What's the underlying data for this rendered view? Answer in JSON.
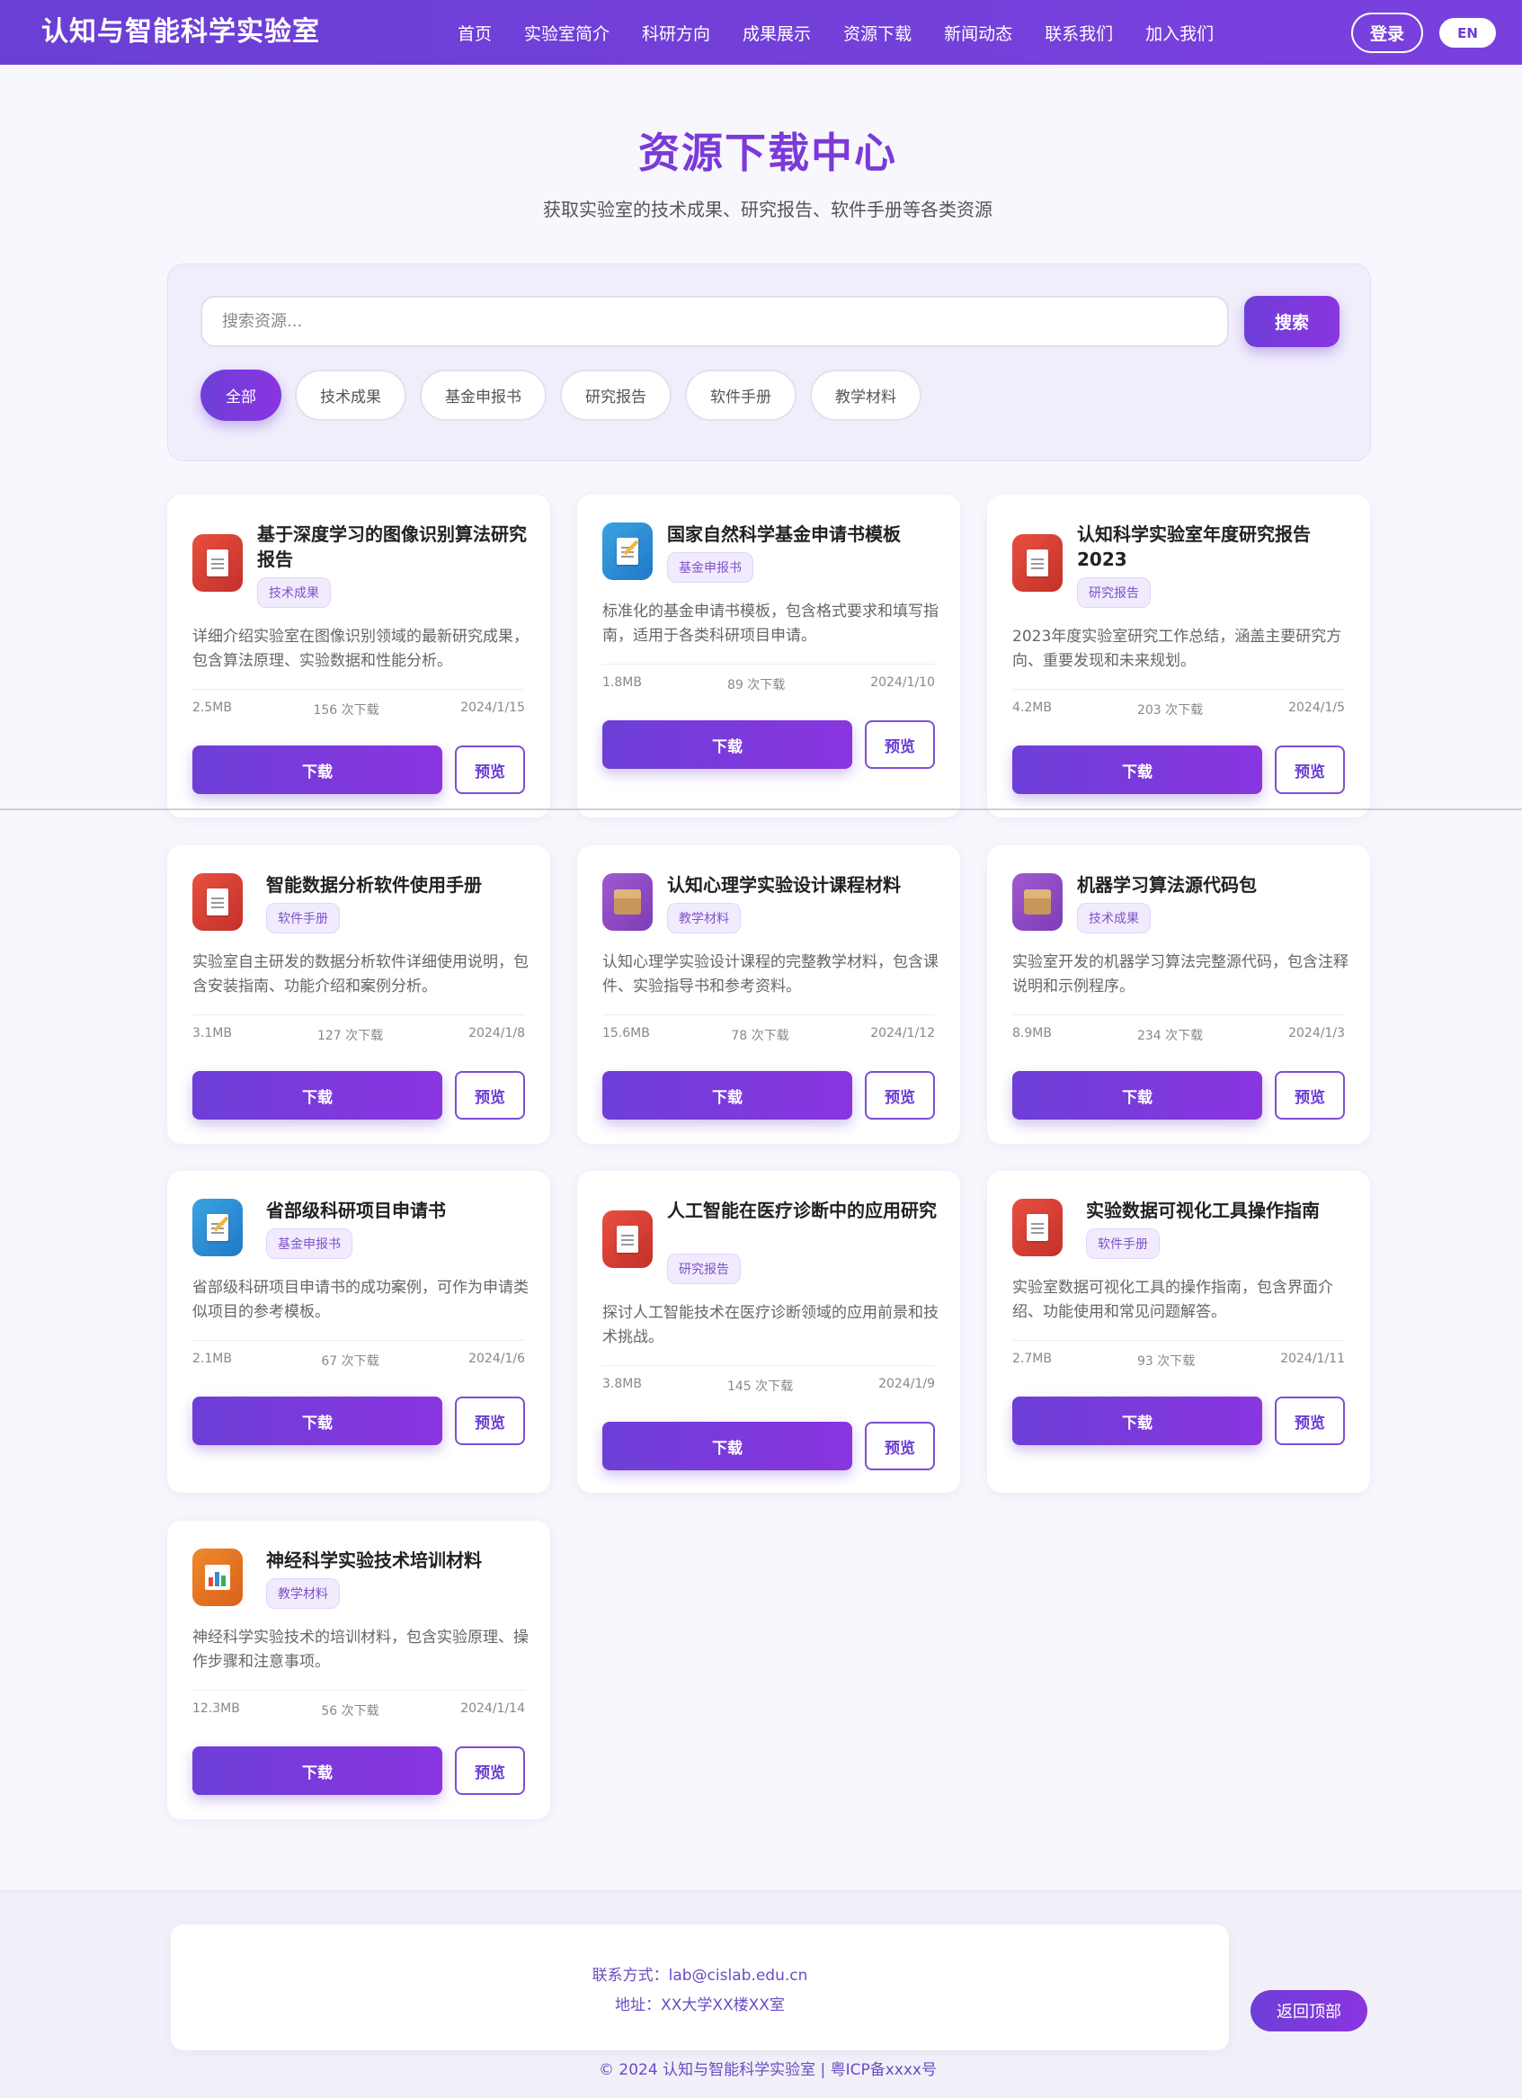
{
  "header": {
    "logo": "认知与智能科学实验室",
    "nav": [
      "首页",
      "实验室简介",
      "科研方向",
      "成果展示",
      "资源下载",
      "新闻动态",
      "联系我们",
      "加入我们"
    ],
    "login_label": "登录",
    "lang_label": "EN"
  },
  "hero": {
    "title": "资源下载中心",
    "subtitle": "获取实验室的技术成果、研究报告、软件手册等各类资源"
  },
  "search": {
    "placeholder": "搜索资源...",
    "button_label": "搜索",
    "filters": [
      "全部",
      "技术成果",
      "基金申报书",
      "研究报告",
      "软件手册",
      "教学材料"
    ],
    "active_filter": "全部"
  },
  "resources": [
    {
      "title": "基于深度学习的图像识别算法研究报告",
      "tag": "技术成果",
      "desc": "详细介绍实验室在图像识别领域的最新研究成果，包含算法原理、实验数据和性能分析。",
      "size": "2.5MB",
      "downloads": "156 次下载",
      "date": "2024/1/15",
      "icon": "document-icon",
      "color": "#d9412f"
    },
    {
      "title": "国家自然科学基金申请书模板",
      "tag": "基金申报书",
      "desc": "标准化的基金申请书模板，包含格式要求和填写指南，适用于各类科研项目申请。",
      "size": "1.8MB",
      "downloads": "89 次下载",
      "date": "2024/1/10",
      "icon": "memo-icon",
      "color": "#2d8ed6"
    },
    {
      "title": "认知科学实验室年度研究报告2023",
      "tag": "研究报告",
      "desc": "2023年度实验室研究工作总结，涵盖主要研究方向、重要发现和未来规划。",
      "size": "4.2MB",
      "downloads": "203 次下载",
      "date": "2024/1/5",
      "icon": "document-icon",
      "color": "#d9412f"
    },
    {
      "title": "智能数据分析软件使用手册",
      "tag": "软件手册",
      "desc": "实验室自主研发的数据分析软件详细使用说明，包含安装指南、功能介绍和案例分析。",
      "size": "3.1MB",
      "downloads": "127 次下载",
      "date": "2024/1/8",
      "icon": "document-icon",
      "color": "#d9412f"
    },
    {
      "title": "认知心理学实验设计课程材料",
      "tag": "教学材料",
      "desc": "认知心理学实验设计课程的完整教学材料，包含课件、实验指导书和参考资料。",
      "size": "15.6MB",
      "downloads": "78 次下载",
      "date": "2024/1/12",
      "icon": "package-icon",
      "color": "#8e4bc4"
    },
    {
      "title": "机器学习算法源代码包",
      "tag": "技术成果",
      "desc": "实验室开发的机器学习算法完整源代码，包含注释说明和示例程序。",
      "size": "8.9MB",
      "downloads": "234 次下载",
      "date": "2024/1/3",
      "icon": "package-icon",
      "color": "#8e4bc4"
    },
    {
      "title": "省部级科研项目申请书",
      "tag": "基金申报书",
      "desc": "省部级科研项目申请书的成功案例，可作为申请类似项目的参考模板。",
      "size": "2.1MB",
      "downloads": "67 次下载",
      "date": "2024/1/6",
      "icon": "memo-icon",
      "color": "#2d8ed6"
    },
    {
      "title": "人工智能在医疗诊断中的应用研究",
      "tag": "研究报告",
      "desc": "探讨人工智能技术在医疗诊断领域的应用前景和技术挑战。",
      "size": "3.8MB",
      "downloads": "145 次下载",
      "date": "2024/1/9",
      "icon": "document-icon",
      "color": "#d9412f"
    },
    {
      "title": "实验数据可视化工具操作指南",
      "tag": "软件手册",
      "desc": "实验室数据可视化工具的操作指南，包含界面介绍、功能使用和常见问题解答。",
      "size": "2.7MB",
      "downloads": "93 次下载",
      "date": "2024/1/11",
      "icon": "document-icon",
      "color": "#d9412f"
    },
    {
      "title": "神经科学实验技术培训材料",
      "tag": "教学材料",
      "desc": "神经科学实验技术的培训材料，包含实验原理、操作步骤和注意事项。",
      "size": "12.3MB",
      "downloads": "56 次下载",
      "date": "2024/1/14",
      "icon": "bar-chart-icon",
      "color": "#e4731f"
    }
  ],
  "card_actions": {
    "download_label": "下载",
    "preview_label": "预览"
  },
  "footer": {
    "contact": "联系方式：lab@cislab.edu.cn",
    "address": "地址：XX大学XX楼XX室",
    "back_to_top": "返回顶部",
    "copyright": "© 2024 认知与智能科学实验室 | 粤ICP备xxxx号"
  },
  "colors": {
    "primary": "#6b3fd4",
    "accent": "#8a35e0",
    "title": "#7b3ad8"
  }
}
